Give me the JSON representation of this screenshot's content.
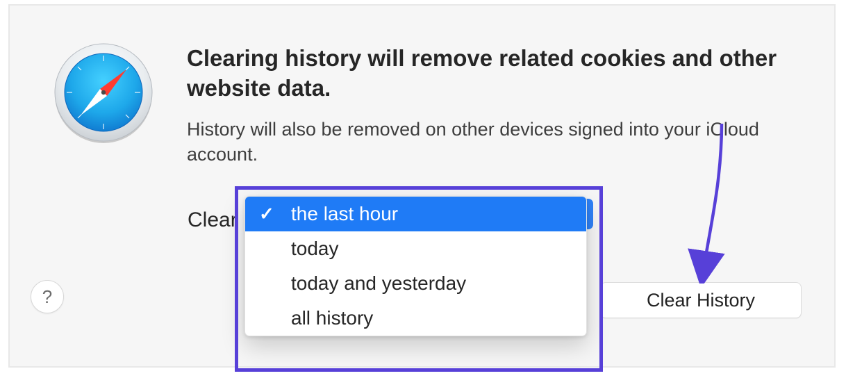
{
  "dialog": {
    "heading": "Clearing history will remove related cookies and other website data.",
    "subtext": "History will also be removed on other devices signed into your iCloud account.",
    "clear_label_prefix": "Clear",
    "help_label": "?",
    "clear_history_button": "Clear History"
  },
  "dropdown": {
    "selected_index": 0,
    "options": [
      "the last hour",
      "today",
      "today and yesterday",
      "all history"
    ]
  },
  "annotation": {
    "highlight_color": "#5740d8",
    "arrow_color": "#5740d8"
  },
  "icon": {
    "name": "safari-icon"
  }
}
